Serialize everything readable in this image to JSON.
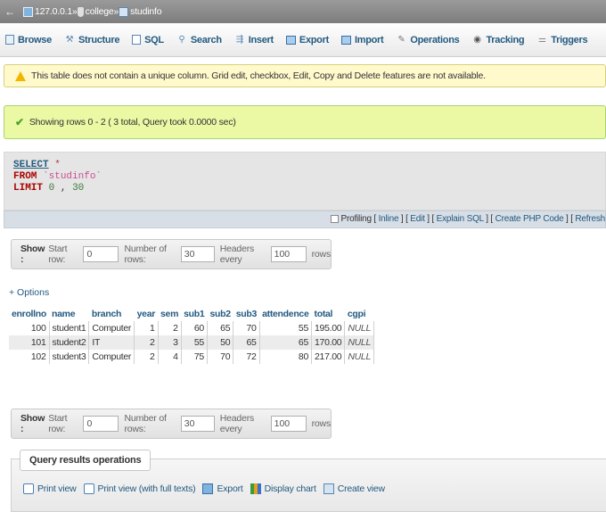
{
  "breadcrumb": {
    "server": "127.0.0.1",
    "database": "college",
    "table": "studinfo",
    "separator": "»"
  },
  "tabs": [
    {
      "label": "Browse",
      "icon": "browse-icon"
    },
    {
      "label": "Structure",
      "icon": "structure-icon"
    },
    {
      "label": "SQL",
      "icon": "sql-icon"
    },
    {
      "label": "Search",
      "icon": "search-icon"
    },
    {
      "label": "Insert",
      "icon": "insert-icon"
    },
    {
      "label": "Export",
      "icon": "export-icon"
    },
    {
      "label": "Import",
      "icon": "import-icon"
    },
    {
      "label": "Operations",
      "icon": "wrench-icon"
    },
    {
      "label": "Tracking",
      "icon": "eye-icon"
    },
    {
      "label": "Triggers",
      "icon": "triggers-icon"
    }
  ],
  "warning": "This table does not contain a unique column. Grid edit, checkbox, Edit, Copy and Delete features are not available.",
  "success": "Showing rows 0 - 2 ( 3 total, Query took 0.0000 sec)",
  "sql": {
    "select": "SELECT",
    "star": "*",
    "from": "FROM",
    "table": "`studinfo`",
    "limit": "LIMIT",
    "offset": "0",
    "comma": ",",
    "count": "30"
  },
  "sql_links": {
    "profiling": "Profiling",
    "inline": "Inline",
    "edit": "Edit",
    "explain": "Explain SQL",
    "create_php": "Create PHP Code",
    "refresh": "Refresh"
  },
  "nav": {
    "show_label": "Show :",
    "start_row_label": "Start row:",
    "start_row_value": "0",
    "num_rows_label": "Number of rows:",
    "num_rows_value": "30",
    "headers_every_label": "Headers every",
    "headers_every_value": "100",
    "rows_label": "rows"
  },
  "options_link": "+ Options",
  "table": {
    "columns": [
      "enrollno",
      "name",
      "branch",
      "year",
      "sem",
      "sub1",
      "sub2",
      "sub3",
      "attendence",
      "total",
      "cgpi"
    ],
    "rows": [
      [
        "100",
        "student1",
        "Computer",
        "1",
        "2",
        "60",
        "65",
        "70",
        "55",
        "195.00",
        "NULL"
      ],
      [
        "101",
        "student2",
        "IT",
        "2",
        "3",
        "55",
        "50",
        "65",
        "65",
        "170.00",
        "NULL"
      ],
      [
        "102",
        "student3",
        "Computer",
        "2",
        "4",
        "75",
        "70",
        "72",
        "80",
        "217.00",
        "NULL"
      ]
    ]
  },
  "operations": {
    "legend": "Query results operations",
    "links": [
      {
        "label": "Print view",
        "icon": "print-icon"
      },
      {
        "label": "Print view (with full texts)",
        "icon": "print-icon"
      },
      {
        "label": "Export",
        "icon": "export-icon"
      },
      {
        "label": "Display chart",
        "icon": "chart-icon"
      },
      {
        "label": "Create view",
        "icon": "view-icon"
      }
    ]
  }
}
